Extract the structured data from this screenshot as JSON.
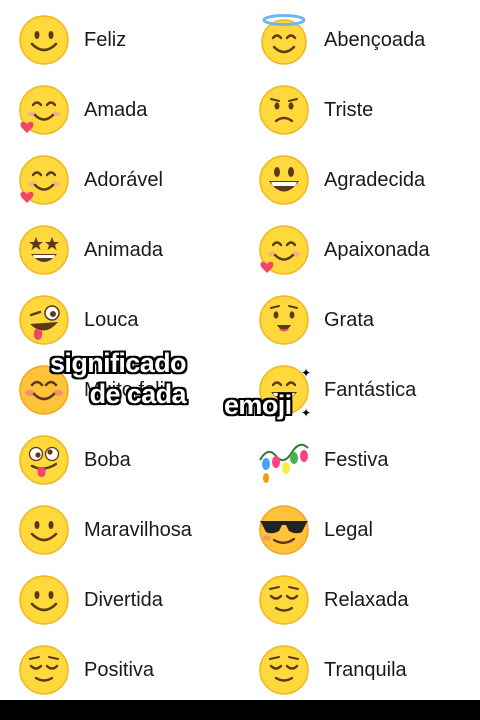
{
  "items_left": [
    {
      "label": "Feliz",
      "icon": "smiling-face-icon"
    },
    {
      "label": "Amada",
      "icon": "smiling-face-with-heart-icon"
    },
    {
      "label": "Adorável",
      "icon": "smiling-face-with-heart-icon"
    },
    {
      "label": "Animada",
      "icon": "star-struck-face-icon"
    },
    {
      "label": "Louca",
      "icon": "zany-face-icon"
    },
    {
      "label": "Muito feliz",
      "icon": "blushing-smile-face-icon"
    },
    {
      "label": "Boba",
      "icon": "goofy-face-icon"
    },
    {
      "label": "Maravilhosa",
      "icon": "smiling-face-icon"
    },
    {
      "label": "Divertida",
      "icon": "smiling-face-icon"
    },
    {
      "label": "Positiva",
      "icon": "relieved-face-icon"
    }
  ],
  "items_right": [
    {
      "label": "Abençoada",
      "icon": "halo-face-icon"
    },
    {
      "label": "Triste",
      "icon": "sad-face-icon"
    },
    {
      "label": "Agradecida",
      "icon": "grinning-face-icon"
    },
    {
      "label": "Apaixonada",
      "icon": "smiling-face-with-heart-icon"
    },
    {
      "label": "Grata",
      "icon": "hopeful-face-icon"
    },
    {
      "label": "Fantástica",
      "icon": "grinning-face-icon"
    },
    {
      "label": "Festiva",
      "icon": "party-lights-icon"
    },
    {
      "label": "Legal",
      "icon": "sunglasses-face-icon"
    },
    {
      "label": "Relaxada",
      "icon": "relieved-face-icon"
    },
    {
      "label": "Tranquila",
      "icon": "relieved-face-icon"
    }
  ],
  "overlay_text": {
    "line1": "significado de cada",
    "line2": "emoji"
  },
  "colors": {
    "face": "#FFD83B",
    "face_edge": "#F2B51D",
    "feature": "#5A3A1A",
    "heart": "#F2446B"
  }
}
